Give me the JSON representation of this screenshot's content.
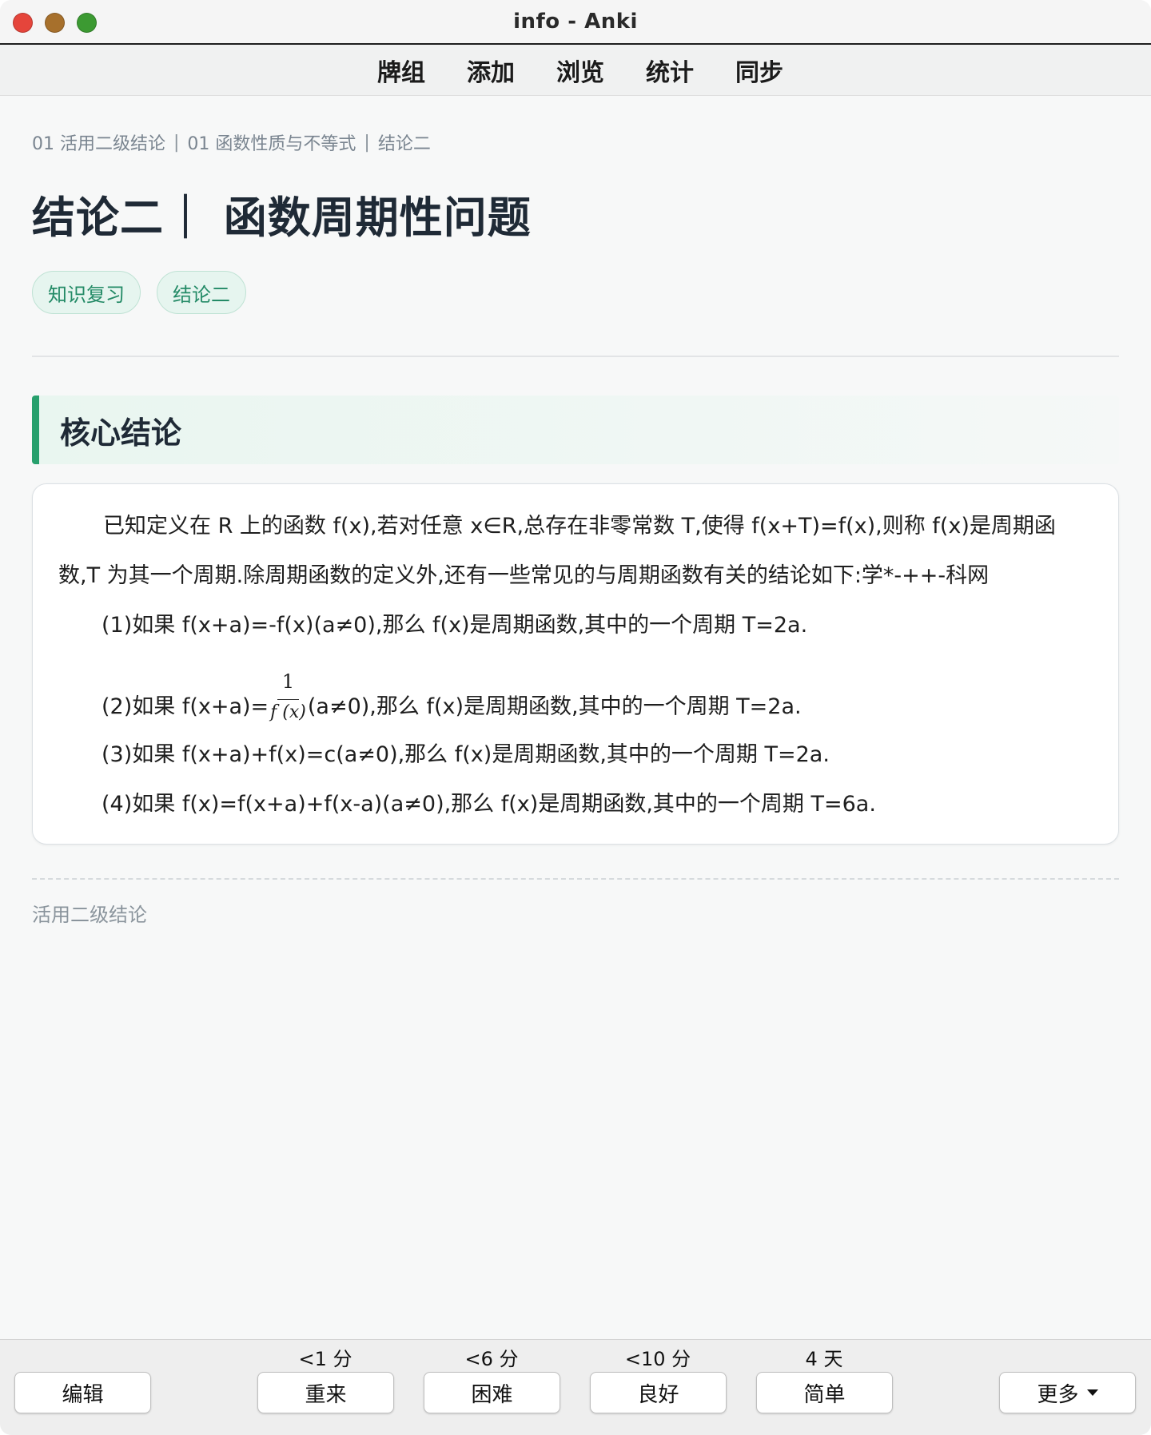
{
  "window": {
    "title": "info - Anki"
  },
  "topnav": {
    "items": [
      "牌组",
      "添加",
      "浏览",
      "统计",
      "同步"
    ]
  },
  "breadcrumb": [
    "01 活用二级结论",
    "01 函数性质与不等式",
    "结论二"
  ],
  "page_title": "结论二｜ 函数周期性问题",
  "tags": [
    "知识复习",
    "结论二"
  ],
  "section": {
    "title": "核心结论",
    "intro": "已知定义在 R 上的函数 f(x),若对任意 x∈R,总存在非零常数 T,使得 f(x+T)=f(x),则称 f(x)是周期函数,T 为其一个周期.除周期函数的定义外,还有一些常见的与周期函数有关的结论如下:学*-++-科网",
    "item1": "(1)如果 f(x+a)=-f(x)(a≠0),那么 f(x)是周期函数,其中的一个周期 T=2a.",
    "item2_prefix": "(2)如果 f(x+a)=",
    "item2_frac_num": "1",
    "item2_frac_den": "f (x)",
    "item2_suffix": "(a≠0),那么 f(x)是周期函数,其中的一个周期 T=2a.",
    "item3": "(3)如果 f(x+a)+f(x)=c(a≠0),那么 f(x)是周期函数,其中的一个周期 T=2a.",
    "item4": "(4)如果 f(x)=f(x+a)+f(x-a)(a≠0),那么 f(x)是周期函数,其中的一个周期 T=6a."
  },
  "footer_note": "活用二级结论",
  "bottombar": {
    "edit_label": "编辑",
    "more_label": "更多",
    "answers": [
      {
        "interval": "<1 分",
        "label": "重来"
      },
      {
        "interval": "<6 分",
        "label": "困难"
      },
      {
        "interval": "<10 分",
        "label": "良好"
      },
      {
        "interval": "4 天",
        "label": "简单"
      }
    ]
  },
  "colors": {
    "accent": "#27a06d",
    "tag_bg": "#e6f5ef",
    "tag_text": "#238a66",
    "close": "#e5453b",
    "minimize": "#a7702c",
    "maximize": "#3c9a32"
  }
}
